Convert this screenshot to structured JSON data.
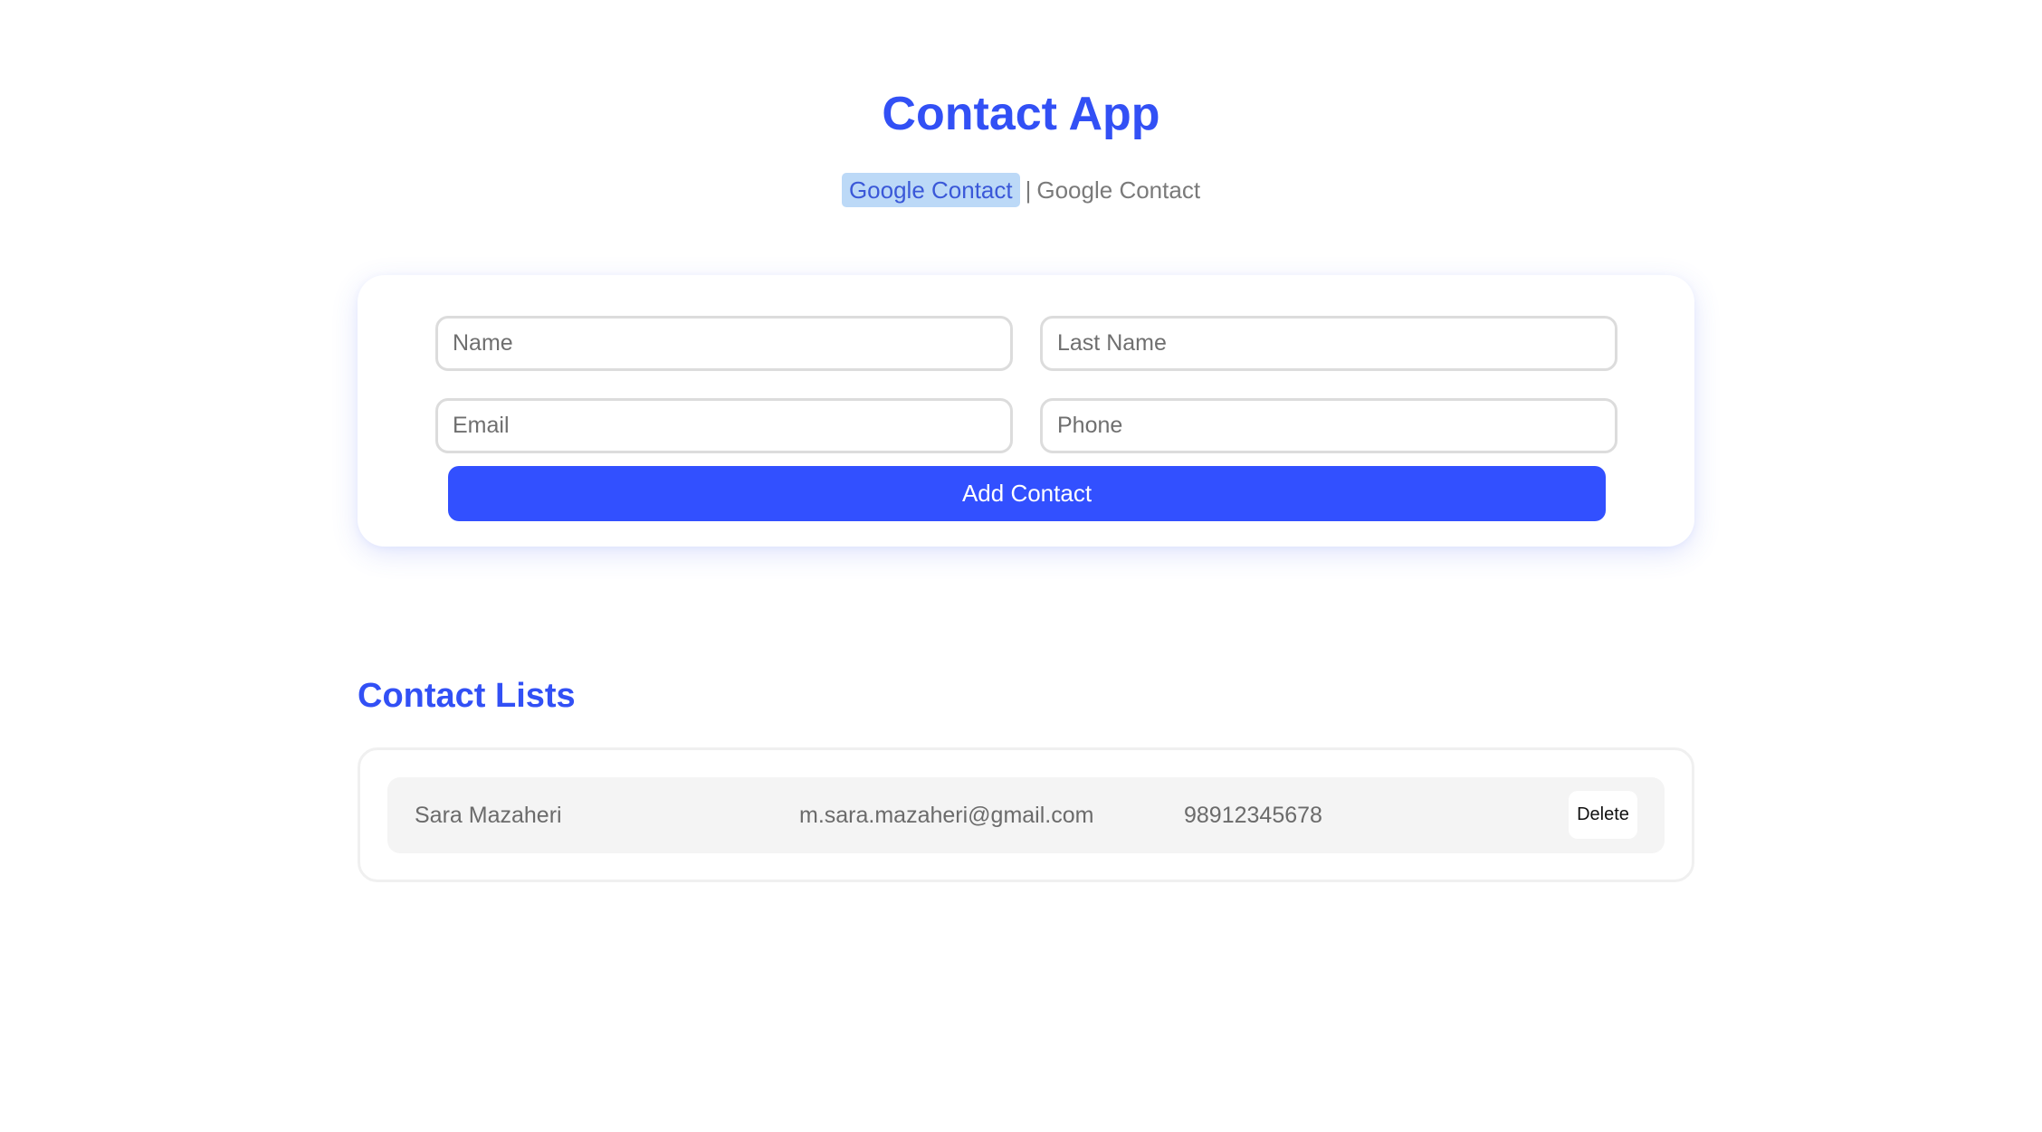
{
  "header": {
    "title": "Contact App",
    "nav_active": "Google Contact",
    "separator": "|",
    "nav_inactive": "Google Contact"
  },
  "form": {
    "name": {
      "placeholder": "Name",
      "value": ""
    },
    "last_name": {
      "placeholder": "Last Name",
      "value": ""
    },
    "email": {
      "placeholder": "Email",
      "value": ""
    },
    "phone": {
      "placeholder": "Phone",
      "value": ""
    },
    "submit_label": "Add Contact"
  },
  "list": {
    "title": "Contact Lists",
    "contacts": [
      {
        "name": "Sara Mazaheri",
        "email": "m.sara.mazaheri@gmail.com",
        "phone": "98912345678",
        "delete_label": "Delete"
      }
    ]
  },
  "colors": {
    "accent": "#3250f5",
    "button": "#3250ff",
    "highlight": "#bcd9f7",
    "row_bg": "#f4f4f4"
  }
}
